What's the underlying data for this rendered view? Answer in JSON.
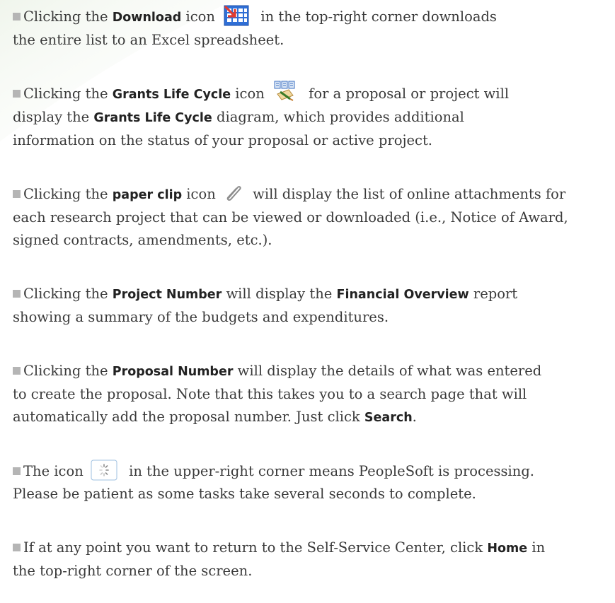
{
  "paragraphs": {
    "p1": {
      "a": "Clicking the ",
      "b1": "Download",
      "c": " icon ",
      "d": " in the top-right corner downloads",
      "e": "the entire list to an Excel spreadsheet."
    },
    "p2": {
      "a": "Clicking the ",
      "b1": "Grants Life Cycle",
      "c": " icon ",
      "d": " for a proposal or project will",
      "e": "display the ",
      "b2": "Grants Life Cycle",
      "f": " diagram, which provides additional",
      "g": "information on the status of your proposal or active project."
    },
    "p3": {
      "a": "Clicking the ",
      "b1": "paper clip",
      "c": " icon ",
      "d": " will display the list of online attachments for",
      "e": "each research project that can be viewed or downloaded (i.e., Notice of Award,",
      "f": "signed contracts, amendments, etc.)."
    },
    "p4": {
      "a": "Clicking the ",
      "b1": "Project Number",
      "c": " will display the ",
      "b2": "Financial Overview",
      "d": " report",
      "e": "showing a summary of the budgets and expenditures."
    },
    "p5": {
      "a": "Clicking the ",
      "b1": "Proposal Number",
      "c": " will display the details of what was entered",
      "d": "to create the proposal. Note that this takes you to a search page that will",
      "e": "automatically add the proposal number. Just click ",
      "b2": "Search",
      "f": "."
    },
    "p6": {
      "a": "The icon ",
      "d": " in the upper-right corner means PeopleSoft is processing.",
      "e": "Please be patient as some tasks take several seconds to complete."
    },
    "p7": {
      "a": "If at any point you want to return to the Self-Service Center, click ",
      "b1": "Home",
      "c": " in",
      "d": "the top-right corner of the screen."
    }
  },
  "icons": {
    "download": "excel-download-icon",
    "grants": "grants-life-cycle-icon",
    "paperclip": "paper-clip-icon",
    "processing": "processing-spinner-icon"
  },
  "colors": {
    "text": "#3a3a3a",
    "bullet": "#b5b5b5",
    "download_blue": "#2f6fd6",
    "download_red": "#e23b2e"
  }
}
